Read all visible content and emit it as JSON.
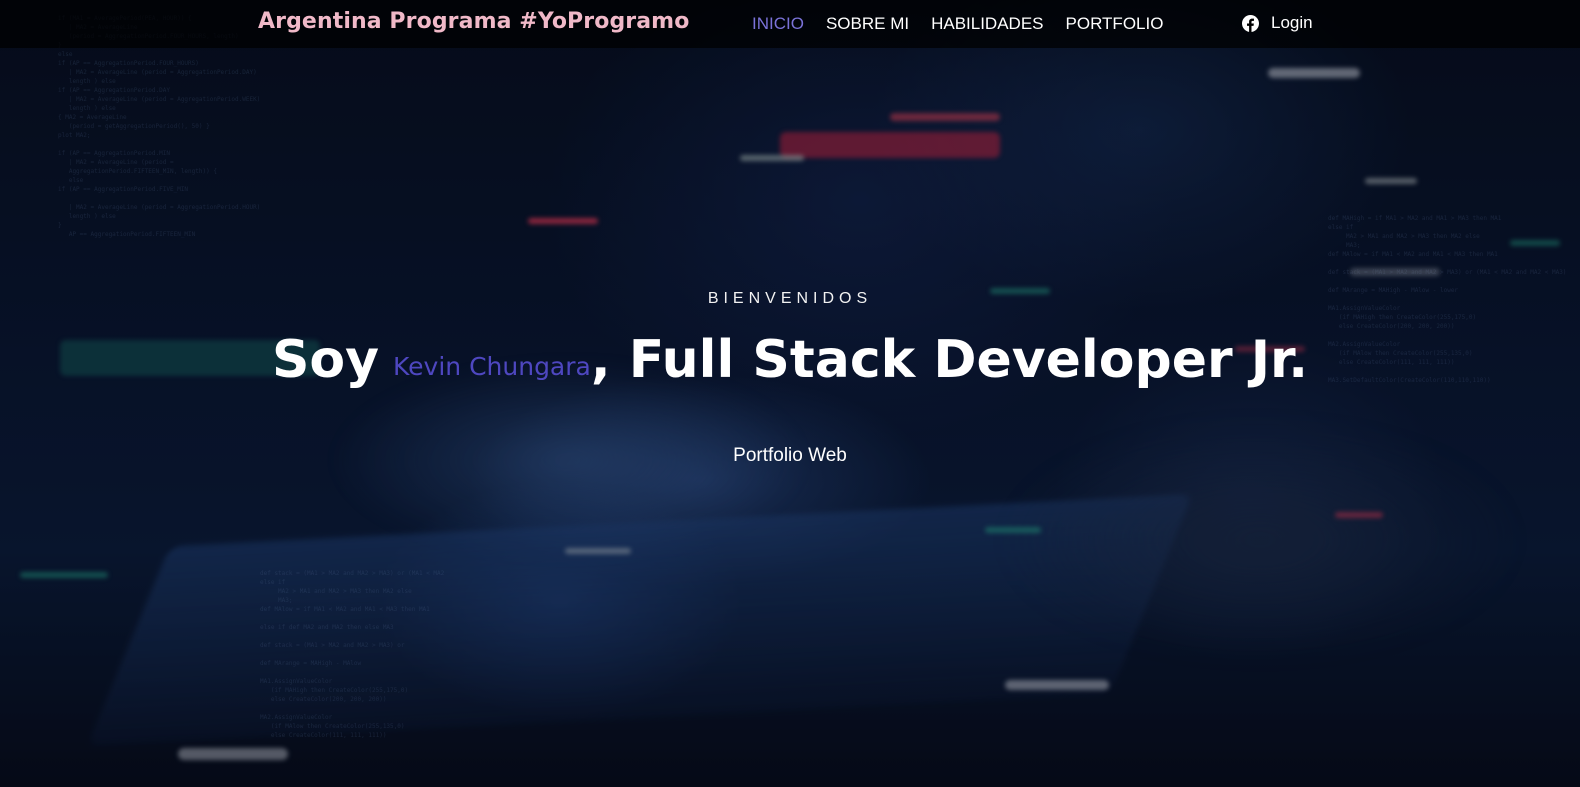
{
  "navbar": {
    "brand": "Argentina Programa #YoProgramo",
    "links": [
      {
        "label": "INICIO",
        "active": true
      },
      {
        "label": "SOBRE MI",
        "active": false
      },
      {
        "label": "HABILIDADES",
        "active": false
      },
      {
        "label": "PORTFOLIO",
        "active": false
      }
    ],
    "login_label": "Login",
    "login_icon": "facebook-icon"
  },
  "hero": {
    "eyebrow": "BIENVENIDOS",
    "prefix": "Soy",
    "name": "Kevin Chungara",
    "suffix": ", Full Stack Developer Jr.",
    "subtitle": "Portfolio Web"
  },
  "colors": {
    "brand": "#f0b9c8",
    "active_link": "#7a72d8",
    "name": "#4e47c0",
    "navbar_bg": "#000000"
  }
}
